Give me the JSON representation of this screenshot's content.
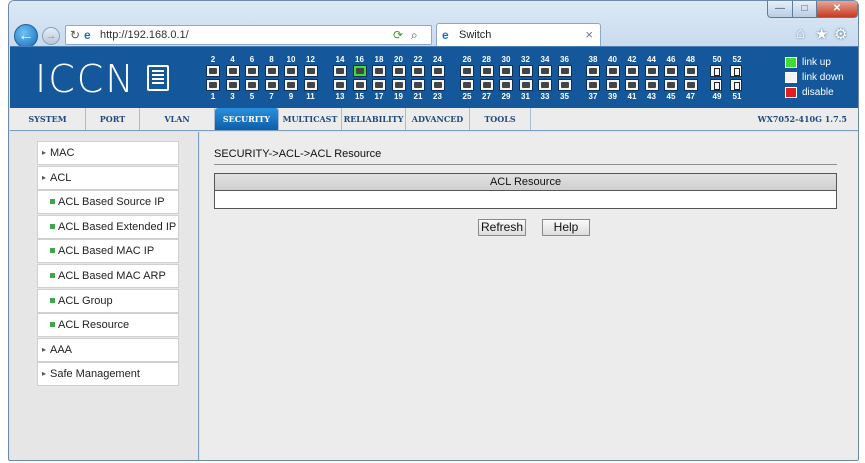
{
  "window": {
    "minimize": "—",
    "maximize": "□",
    "close": "✕"
  },
  "browser": {
    "address": "http://192.168.0.1/",
    "tab_title": "Switch",
    "tab_close": "×",
    "icons": [
      "back-arrow-icon",
      "forward-arrow-icon",
      "refresh-icon",
      "ie-logo-icon",
      "compatibility-icon",
      "search-icon",
      "home-icon",
      "star-icon",
      "gear-icon"
    ],
    "back_glyph": "←",
    "forward_glyph": "→",
    "home_glyph": "⌂",
    "star_glyph": "★",
    "gear_glyph": "⚙"
  },
  "banner": {
    "logo": "ICCN",
    "ports_top_labels": [
      "2",
      "4",
      "6",
      "8",
      "10",
      "12",
      "14",
      "16",
      "18",
      "20",
      "22",
      "24",
      "26",
      "28",
      "30",
      "32",
      "34",
      "36",
      "38",
      "40",
      "42",
      "44",
      "46",
      "48"
    ],
    "ports_bottom_labels": [
      "1",
      "3",
      "5",
      "7",
      "9",
      "11",
      "13",
      "15",
      "17",
      "19",
      "21",
      "23",
      "25",
      "27",
      "29",
      "31",
      "33",
      "35",
      "37",
      "39",
      "41",
      "43",
      "45",
      "47"
    ],
    "fiber_top_labels": [
      "50",
      "52"
    ],
    "fiber_bottom_labels": [
      "49",
      "51"
    ],
    "link_up_port": "16",
    "legend": [
      {
        "label": "link up",
        "color": "#3fdc34"
      },
      {
        "label": "link down",
        "color": "#f4f4f4"
      },
      {
        "label": "disable",
        "color": "#e02020"
      }
    ]
  },
  "menu": {
    "items": [
      "SYSTEM",
      "PORT",
      "VLAN",
      "SECURITY",
      "MULTICAST",
      "RELIABILITY",
      "ADVANCED",
      "TOOLS"
    ],
    "active": "SECURITY",
    "version": "WX7052-410G 1.7.5"
  },
  "sidebar": {
    "items": [
      {
        "label": "MAC",
        "sub": false
      },
      {
        "label": "ACL",
        "sub": false
      },
      {
        "label": "ACL Based Source IP",
        "sub": true
      },
      {
        "label": "ACL Based Extended IP",
        "sub": true
      },
      {
        "label": "ACL Based MAC IP",
        "sub": true
      },
      {
        "label": "ACL Based MAC ARP",
        "sub": true
      },
      {
        "label": "ACL Group",
        "sub": true
      },
      {
        "label": "ACL Resource",
        "sub": true
      },
      {
        "label": "AAA",
        "sub": false
      },
      {
        "label": "Safe Management",
        "sub": false
      }
    ]
  },
  "main": {
    "breadcrumb": "SECURITY->ACL->ACL Resource",
    "table_header": "ACL Resource",
    "refresh_label": "Refresh",
    "help_label": "Help"
  }
}
